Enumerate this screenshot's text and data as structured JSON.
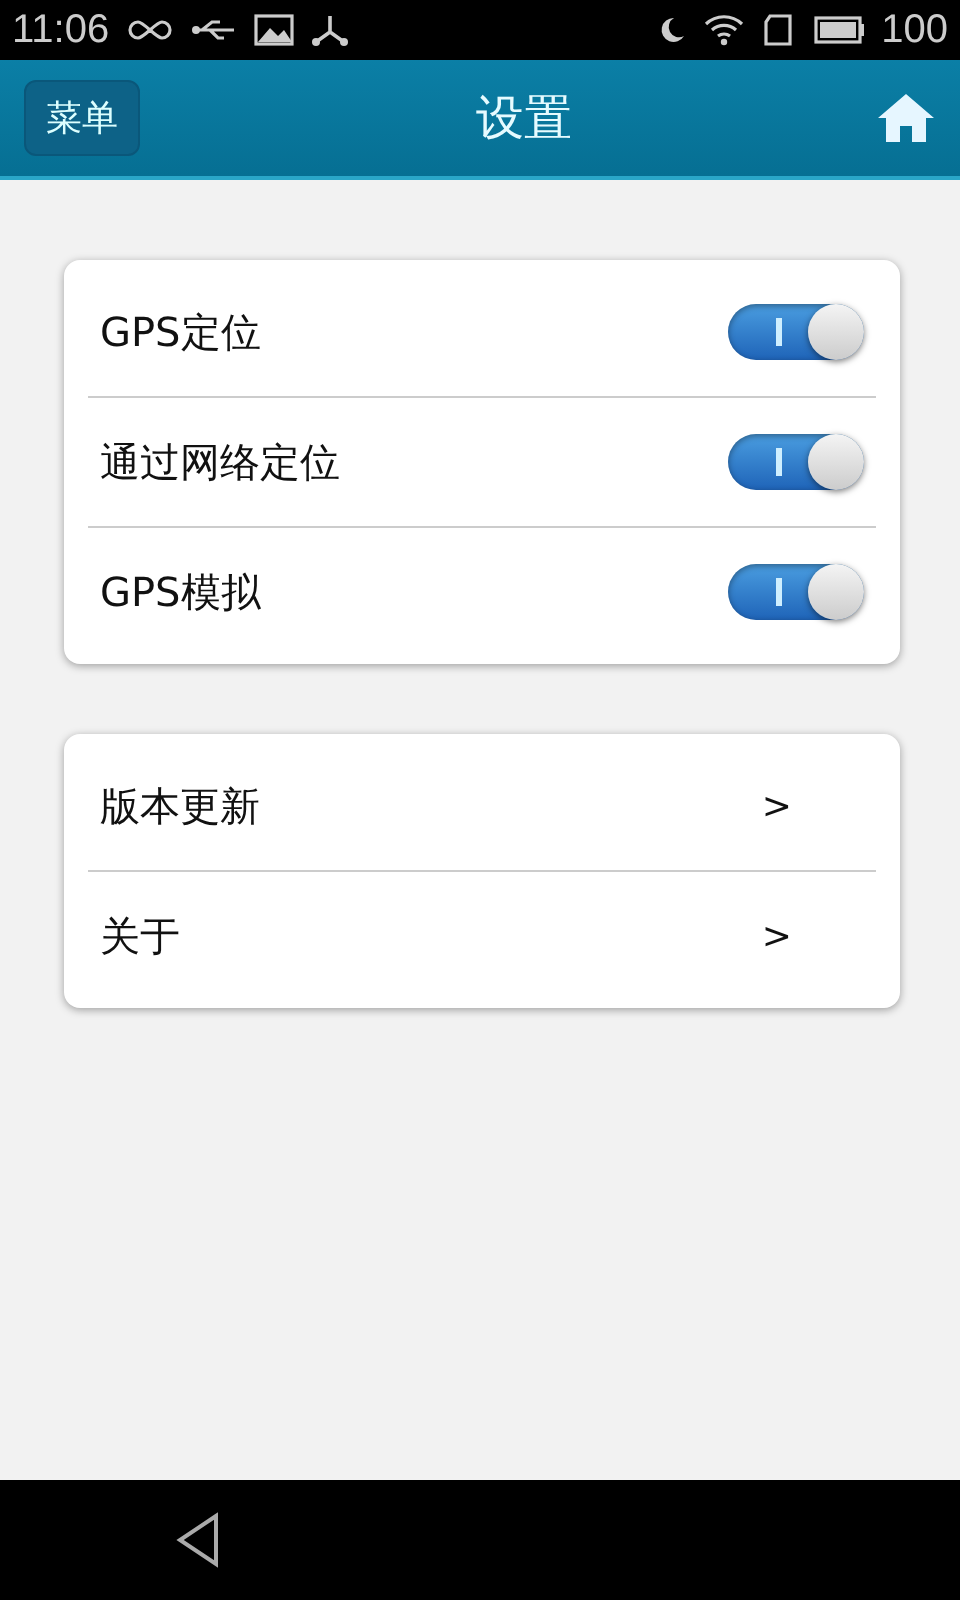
{
  "status_bar": {
    "time": "11:06",
    "battery": "100"
  },
  "header": {
    "menu_button": "菜单",
    "title": "设置"
  },
  "toggles": [
    {
      "label": "GPS定位",
      "on": true
    },
    {
      "label": "通过网络定位",
      "on": true
    },
    {
      "label": "GPS模拟",
      "on": true
    }
  ],
  "links": [
    {
      "label": "版本更新",
      "arrow": ">"
    },
    {
      "label": "关于",
      "arrow": ">"
    }
  ]
}
